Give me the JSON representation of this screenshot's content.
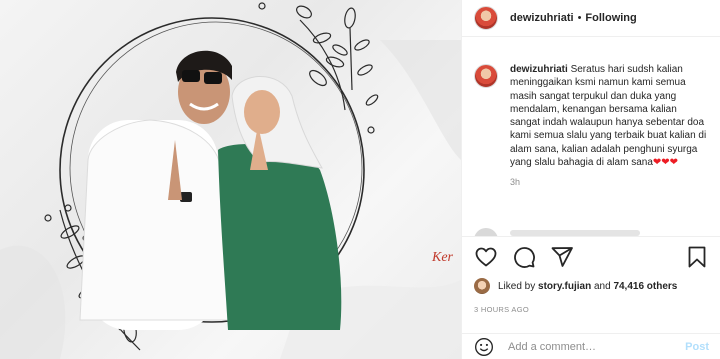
{
  "post": {
    "overlay_text": "Ker"
  },
  "header": {
    "username": "dewizuhriati",
    "separator": "•",
    "follow_label": "Following"
  },
  "caption": {
    "username": "dewizuhriati",
    "text": "Seratus hari sudsh kalian meninggaikan ksmi namun kami semua masih sangat terpukul dan duka yang mendalam, kenangan bersama kalian sangat indah walaupun hanya sebentar doa kami semua slalu yang terbaik buat kalian di alam sana, kalian adalah penghuni syurga yang slalu bahagia di alam sana",
    "hearts": "❤❤❤",
    "time": "3h"
  },
  "actions": {
    "like_icon": "heart-icon",
    "comment_icon": "comment-icon",
    "share_icon": "share-icon",
    "save_icon": "bookmark-icon"
  },
  "likes": {
    "prefix": "Liked by",
    "user": "story.fujian",
    "conjunction": "and",
    "count": "74,416 others"
  },
  "posted_ago": "3 HOURS AGO",
  "add_comment": {
    "placeholder": "Add a comment…",
    "post_label": "Post"
  },
  "colors": {
    "heart_red": "#ed1c24",
    "overlay_text_red": "#c0392b",
    "post_button_disabled": "#b2dffc"
  }
}
